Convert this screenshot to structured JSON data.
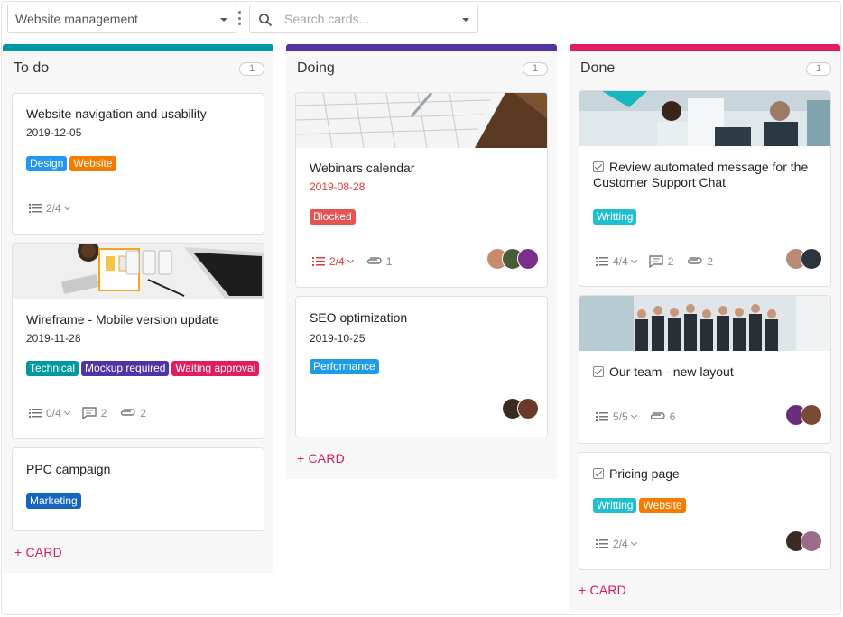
{
  "toolbar": {
    "board": "Website management",
    "search_placeholder": "Search cards..."
  },
  "colors": {
    "todo": "#00999f",
    "doing": "#5233a6",
    "done": "#e11d62",
    "accent": "#d81b60"
  },
  "columns": {
    "todo": {
      "title": "To do",
      "count": "1",
      "add": "+ CARD",
      "cards": [
        {
          "title": "Website navigation and usability",
          "date": "2019-12-05",
          "tags": [
            "Design",
            "Website"
          ],
          "checklist": "2/4"
        },
        {
          "title": "Wireframe - Mobile version update",
          "date": "2019-11-28",
          "tags": [
            "Technical",
            "Mockup required",
            "Waiting approval"
          ],
          "checklist": "0/4",
          "comments": "2",
          "attachments": "2"
        },
        {
          "title": "PPC campaign",
          "tags": [
            "Marketing"
          ]
        }
      ]
    },
    "doing": {
      "title": "Doing",
      "count": "1",
      "add": "+ CARD",
      "cards": [
        {
          "title": "Webinars calendar",
          "date": "2019-08-28",
          "tags": [
            "Blocked"
          ],
          "checklist": "2/4",
          "attachments": "1"
        },
        {
          "title": "SEO optimization",
          "date": "2019-10-25",
          "tags": [
            "Performance"
          ]
        }
      ]
    },
    "done": {
      "title": "Done",
      "count": "1",
      "add": "+ CARD",
      "cards": [
        {
          "title": "Review automated message for the Customer Support Chat",
          "tags": [
            "Writting"
          ],
          "checklist": "4/4",
          "comments": "2",
          "attachments": "2"
        },
        {
          "title": "Our team - new layout",
          "checklist": "5/5",
          "attachments": "6"
        },
        {
          "title": "Pricing page",
          "tags": [
            "Writting",
            "Website"
          ],
          "checklist": "2/4"
        }
      ]
    }
  }
}
